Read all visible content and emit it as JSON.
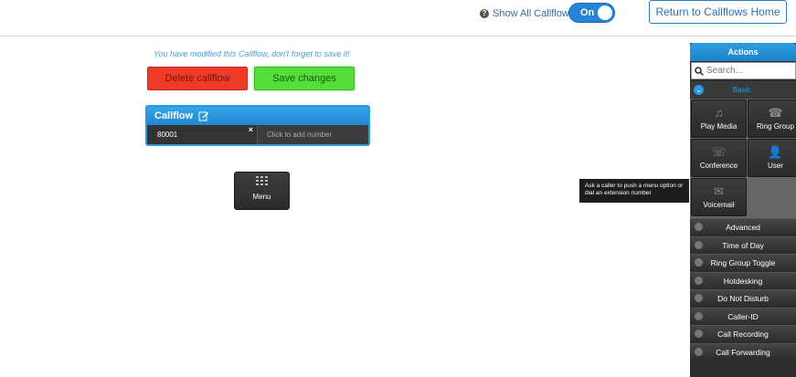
{
  "topbar": {
    "show_all_label": "Show All Callflows",
    "toggle_label": "On",
    "return_label": "Return to Callflows Home"
  },
  "editor": {
    "notice": "You have modified this Callflow, don't forget to save it!",
    "delete_label": "Delete callflow",
    "save_label": "Save changes",
    "callflow_title": "Callflow",
    "number": "80001",
    "add_number_label": "Click to add number",
    "menu_node_label": "Menu"
  },
  "tooltip": "Ask a caller to push a menu option or dial an extension number",
  "actions": {
    "title": "Actions",
    "search_placeholder": "Search...",
    "basic_label": "Basic",
    "tiles": [
      {
        "label": "Play Media",
        "icon": "music-note-icon"
      },
      {
        "label": "Ring Group",
        "icon": "ring-group-icon"
      },
      {
        "label": "Conference",
        "icon": "conference-icon"
      },
      {
        "label": "User",
        "icon": "user-icon"
      },
      {
        "label": "Voicemail",
        "icon": "envelope-icon"
      }
    ],
    "categories": [
      "Advanced",
      "Time of Day",
      "Ring Group Toggle",
      "Hotdesking",
      "Do Not Disturb",
      "Caller-ID",
      "Call Recording",
      "Call Forwarding"
    ]
  },
  "colors": {
    "accent": "#2384d8",
    "delete": "#ee3a26",
    "save": "#55dd3a",
    "panel": "#2d2d2d"
  }
}
